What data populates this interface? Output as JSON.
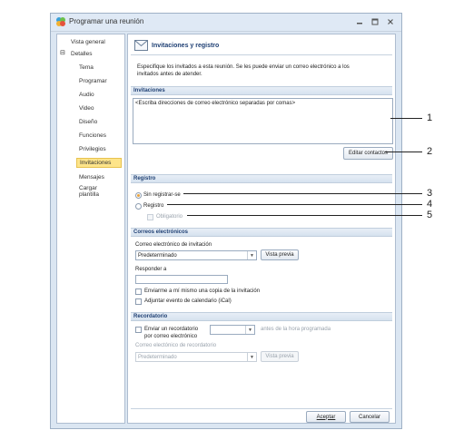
{
  "window": {
    "title": "Programar una reunión"
  },
  "nav": {
    "vista_general": "Vista general",
    "expander": "⊟",
    "detalles": "Detalles",
    "items": [
      "Tema",
      "Programar",
      "Audio",
      "Video",
      "Diseño",
      "Funciones",
      "Privilegios",
      "Invitaciones",
      "Mensajes",
      "Cargar plantilla"
    ],
    "selected": "Invitaciones"
  },
  "header": {
    "title": "Invitaciones y registro"
  },
  "intro": {
    "line1": "Especifique los invitados a esta reunión.  Se les puede enviar un correo electrónico a los",
    "line2": "invitados antes de atender."
  },
  "invitaciones": {
    "section": "Invitaciones",
    "placeholder": "<Escriba direcciones de correo electrónico separadas por comas>",
    "edit_button": "Editar contactos"
  },
  "registro": {
    "section": "Registro",
    "sin_registrarse": "Sin registrar-se",
    "registro": "Registro",
    "obligatorio": "Obligatorio"
  },
  "correos": {
    "section": "Correos electrónicos",
    "invitation_label": "Correo electrónico de invitación",
    "invitation_value": "Predeterminado",
    "preview_button": "Vista previa",
    "reply_label": "Responder a",
    "reply_value": "",
    "copy_label": "Enviarme a mí mismo una copia de la invitación",
    "ical_label": "Adjuntar evento de calendario (iCal)"
  },
  "recordatorio": {
    "section": "Recordatorio",
    "send_label_1": "Enviar un recordatorio",
    "send_label_2": "por correo electrónico",
    "time_value": "",
    "suffix": "antes de la hora programada",
    "email_label": "Correo electónico de recordatorio",
    "email_value": "Predeterminado",
    "preview_button": "Vista previa"
  },
  "footer": {
    "accept": "Aceptar",
    "cancel": "Cancelar"
  },
  "callouts": [
    "1",
    "2",
    "3",
    "4",
    "5"
  ]
}
